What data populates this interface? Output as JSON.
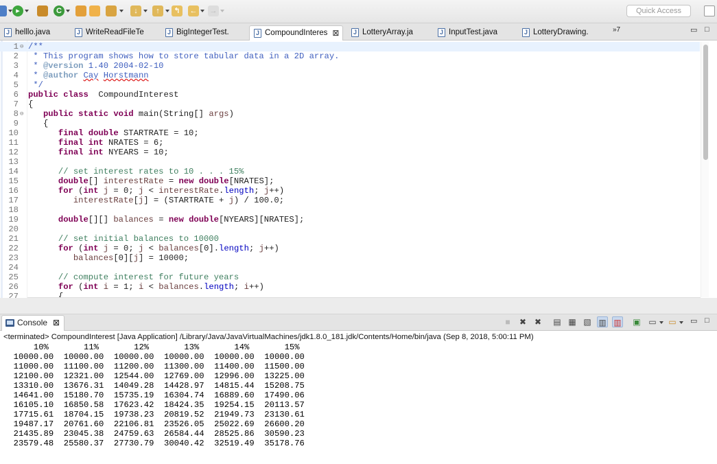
{
  "toolbar": {
    "quick_access_placeholder": "Quick Access",
    "icons": [
      "debug-icon",
      "run-icon",
      "new-package-icon",
      "new-class-icon",
      "open-type-icon",
      "open-folder-icon",
      "search-icon",
      "next-annotation-icon",
      "prev-annotation-icon",
      "last-edit-icon",
      "back-icon",
      "forward-icon",
      "perspective-icon"
    ]
  },
  "editor_tabs": [
    {
      "label": "helllo.java",
      "active": false
    },
    {
      "label": "WriteReadFileTe",
      "active": false
    },
    {
      "label": "BigIntegerTest.",
      "active": false
    },
    {
      "label": "CompoundInteres",
      "active": true
    },
    {
      "label": "LotteryArray.ja",
      "active": false
    },
    {
      "label": "InputTest.java",
      "active": false
    },
    {
      "label": "LotteryDrawing.",
      "active": false
    }
  ],
  "tab_overflow": "»7",
  "editor": {
    "lines": [
      {
        "n": "1",
        "fold": "⊖",
        "segs": [
          [
            "jd",
            "/**"
          ]
        ]
      },
      {
        "n": "2",
        "segs": [
          [
            "jd",
            " * This program shows how to store tabular data in a 2D array."
          ]
        ]
      },
      {
        "n": "3",
        "segs": [
          [
            "jd",
            " * "
          ],
          [
            "jdtag",
            "@version"
          ],
          [
            "jd",
            " 1.40 2004-02-10"
          ]
        ]
      },
      {
        "n": "4",
        "segs": [
          [
            "jd",
            " * "
          ],
          [
            "jdtag",
            "@author"
          ],
          [
            "jd",
            " "
          ],
          [
            "jdsq",
            "Cay"
          ],
          [
            "jd",
            " "
          ],
          [
            "jdsq",
            "Horstmann"
          ]
        ]
      },
      {
        "n": "5",
        "segs": [
          [
            "jd",
            " */"
          ]
        ]
      },
      {
        "n": "6",
        "segs": [
          [
            "kw",
            "public class"
          ],
          [
            "",
            "  CompoundInterest"
          ]
        ]
      },
      {
        "n": "7",
        "segs": [
          [
            "",
            "{"
          ]
        ]
      },
      {
        "n": "8",
        "fold": "⊖",
        "segs": [
          [
            "",
            "   "
          ],
          [
            "kw",
            "public static void"
          ],
          [
            "",
            " main(String[] "
          ],
          [
            "var",
            "args"
          ],
          [
            "",
            ")"
          ]
        ]
      },
      {
        "n": "9",
        "segs": [
          [
            "",
            "   {"
          ]
        ]
      },
      {
        "n": "10",
        "segs": [
          [
            "",
            "      "
          ],
          [
            "kw",
            "final double"
          ],
          [
            "",
            " STARTRATE = 10;"
          ]
        ]
      },
      {
        "n": "11",
        "segs": [
          [
            "",
            "      "
          ],
          [
            "kw",
            "final int"
          ],
          [
            "",
            " NRATES = 6;"
          ]
        ]
      },
      {
        "n": "12",
        "segs": [
          [
            "",
            "      "
          ],
          [
            "kw",
            "final int"
          ],
          [
            "",
            " NYEARS = 10;"
          ]
        ]
      },
      {
        "n": "13",
        "segs": [
          [
            "",
            ""
          ]
        ]
      },
      {
        "n": "14",
        "segs": [
          [
            "",
            "      "
          ],
          [
            "cm",
            "// set interest rates to 10 . . . 15%"
          ]
        ]
      },
      {
        "n": "15",
        "segs": [
          [
            "",
            "      "
          ],
          [
            "kw",
            "double"
          ],
          [
            "",
            "[] "
          ],
          [
            "var",
            "interestRate"
          ],
          [
            "",
            " = "
          ],
          [
            "kw",
            "new double"
          ],
          [
            "",
            "[NRATES];"
          ]
        ]
      },
      {
        "n": "16",
        "segs": [
          [
            "",
            "      "
          ],
          [
            "kw",
            "for"
          ],
          [
            "",
            " ("
          ],
          [
            "kw",
            "int"
          ],
          [
            "",
            " "
          ],
          [
            "var",
            "j"
          ],
          [
            "",
            " = 0; "
          ],
          [
            "var",
            "j"
          ],
          [
            "",
            " < "
          ],
          [
            "var",
            "interestRate"
          ],
          [
            "",
            "."
          ],
          [
            "fld",
            "length"
          ],
          [
            "",
            "; "
          ],
          [
            "var",
            "j"
          ],
          [
            "",
            "++)"
          ]
        ]
      },
      {
        "n": "17",
        "segs": [
          [
            "",
            "         "
          ],
          [
            "var",
            "interestRate"
          ],
          [
            "",
            "["
          ],
          [
            "var",
            "j"
          ],
          [
            "",
            "] = (STARTRATE + "
          ],
          [
            "var",
            "j"
          ],
          [
            "",
            ") / 100.0;"
          ]
        ]
      },
      {
        "n": "18",
        "segs": [
          [
            "",
            ""
          ]
        ]
      },
      {
        "n": "19",
        "segs": [
          [
            "",
            "      "
          ],
          [
            "kw",
            "double"
          ],
          [
            "",
            "[][] "
          ],
          [
            "var",
            "balances"
          ],
          [
            "",
            " = "
          ],
          [
            "kw",
            "new double"
          ],
          [
            "",
            "[NYEARS][NRATES];"
          ]
        ]
      },
      {
        "n": "20",
        "segs": [
          [
            "",
            ""
          ]
        ]
      },
      {
        "n": "21",
        "segs": [
          [
            "",
            "      "
          ],
          [
            "cm",
            "// set initial balances to 10000"
          ]
        ]
      },
      {
        "n": "22",
        "segs": [
          [
            "",
            "      "
          ],
          [
            "kw",
            "for"
          ],
          [
            "",
            " ("
          ],
          [
            "kw",
            "int"
          ],
          [
            "",
            " "
          ],
          [
            "var",
            "j"
          ],
          [
            "",
            " = 0; "
          ],
          [
            "var",
            "j"
          ],
          [
            "",
            " < "
          ],
          [
            "var",
            "balances"
          ],
          [
            "",
            "[0]."
          ],
          [
            "fld",
            "length"
          ],
          [
            "",
            "; "
          ],
          [
            "var",
            "j"
          ],
          [
            "",
            "++)"
          ]
        ]
      },
      {
        "n": "23",
        "segs": [
          [
            "",
            "         "
          ],
          [
            "var",
            "balances"
          ],
          [
            "",
            "[0]["
          ],
          [
            "var",
            "j"
          ],
          [
            "",
            "] = 10000;"
          ]
        ]
      },
      {
        "n": "24",
        "segs": [
          [
            "",
            ""
          ]
        ]
      },
      {
        "n": "25",
        "segs": [
          [
            "",
            "      "
          ],
          [
            "cm",
            "// compute interest for future years"
          ]
        ]
      },
      {
        "n": "26",
        "segs": [
          [
            "",
            "      "
          ],
          [
            "kw",
            "for"
          ],
          [
            "",
            " ("
          ],
          [
            "kw",
            "int"
          ],
          [
            "",
            " "
          ],
          [
            "var",
            "i"
          ],
          [
            "",
            " = 1; "
          ],
          [
            "var",
            "i"
          ],
          [
            "",
            " < "
          ],
          [
            "var",
            "balances"
          ],
          [
            "",
            "."
          ],
          [
            "fld",
            "length"
          ],
          [
            "",
            "; "
          ],
          [
            "var",
            "i"
          ],
          [
            "",
            "++)"
          ]
        ]
      },
      {
        "n": "27",
        "segs": [
          [
            "",
            "      {"
          ]
        ]
      }
    ]
  },
  "console": {
    "tab_label": "Console",
    "terminated_line": "<terminated> CompoundInterest [Java Application] /Library/Java/JavaVirtualMachines/jdk1.8.0_181.jdk/Contents/Home/bin/java (Sep 8, 2018, 5:00:11 PM)",
    "output_lines": [
      "      10%       11%       12%       13%       14%       15%",
      "  10000.00  10000.00  10000.00  10000.00  10000.00  10000.00",
      "  11000.00  11100.00  11200.00  11300.00  11400.00  11500.00",
      "  12100.00  12321.00  12544.00  12769.00  12996.00  13225.00",
      "  13310.00  13676.31  14049.28  14428.97  14815.44  15208.75",
      "  14641.00  15180.70  15735.19  16304.74  16889.60  17490.06",
      "  16105.10  16850.58  17623.42  18424.35  19254.15  20113.57",
      "  17715.61  18704.15  19738.23  20819.52  21949.73  23130.61",
      "  19487.17  20761.60  22106.81  23526.05  25022.69  26600.20",
      "  21435.89  23045.38  24759.63  26584.44  28525.86  30590.23",
      "  23579.48  25580.37  27730.79  30040.42  32519.49  35178.76"
    ]
  }
}
